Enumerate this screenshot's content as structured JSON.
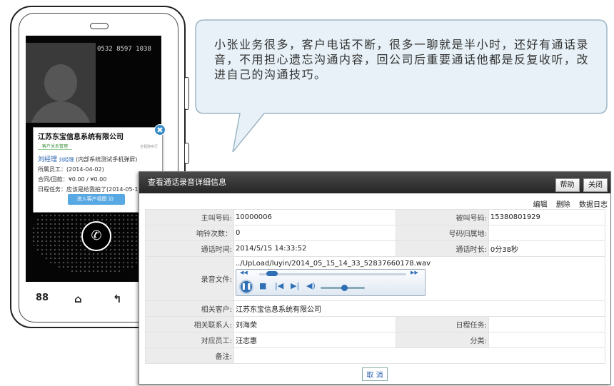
{
  "phone": {
    "number": "0532 8597 1038",
    "popup": {
      "company": "江苏东宝信息系统有限公司",
      "tag": "客户关系管理",
      "tag_right": "全程随身行",
      "contact_name": "刘经理",
      "contact_suffix": "刘经理",
      "contact_note": "(内部系统测试手机弹屏)",
      "staff": "所属员工：(2014-04-02)",
      "contract": "合同/回款：¥0.00 / ¥0.00",
      "schedule": "日程任务：应该是给我拍了(2014-05-1",
      "button": "进入客户视图 》》"
    },
    "nav": [
      "88",
      "⌂",
      "↰"
    ]
  },
  "bubble": {
    "text": "小张业务很多，客户电话不断，很多一聊就是半小时，还好有通话录音，不用担心遗忘沟通内容，回公司后重要通话他都是反复收听，改进自己的沟通技巧。"
  },
  "dialog": {
    "title": "查看通话录音详细信息",
    "help": "帮助",
    "close": "关闭",
    "actions": {
      "edit": "编辑",
      "delete": "删除",
      "log": "数据日志"
    },
    "labels": {
      "caller": "主叫号码:",
      "callee": "被叫号码:",
      "ring": "响铃次数：",
      "location": "号码归属地:",
      "time": "通话时间:",
      "duration": "通话时长:",
      "recording": "录音文件:",
      "customer": "相关客户:",
      "contact": "相关联系人:",
      "schedule": "日程任务:",
      "staff": "对应员工:",
      "category": "分类:",
      "remark": "备注:"
    },
    "values": {
      "caller": "10000006",
      "callee": "15380801929",
      "ring": "0",
      "location": "",
      "time": "2014/5/15 14:33:52",
      "duration": "0分38秒",
      "recording": "../UpLoad/luyin/2014_05_15_14_33_52837660178.wav",
      "customer": "江苏东宝信息系统有限公司",
      "contact": "刘海荣",
      "schedule": "",
      "staff": "汪志惠",
      "category": "",
      "remark": ""
    },
    "player": {
      "progress": 0.05,
      "volume": 0.55
    },
    "cancel": "取 消"
  }
}
